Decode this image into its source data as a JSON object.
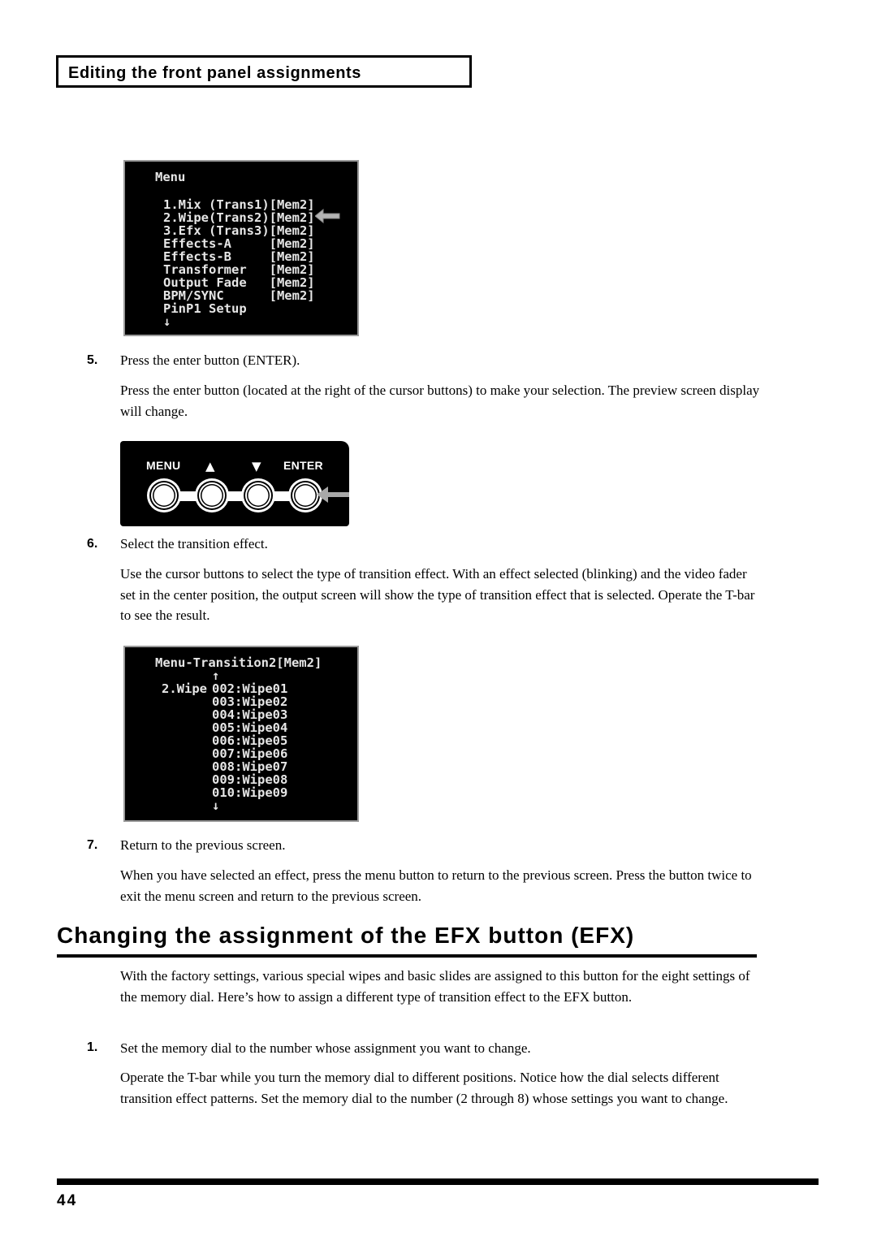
{
  "section_header": "Editing the front panel assignments",
  "screen1": {
    "title": "Menu",
    "items": [
      "1.Mix (Trans1)[Mem2]",
      "2.Wipe(Trans2)[Mem2]",
      "3.Efx (Trans3)[Mem2]",
      "Effects-A     [Mem2]",
      "Effects-B     [Mem2]",
      "Transformer   [Mem2]",
      "Output Fade   [Mem2]",
      "BPM/SYNC      [Mem2]",
      "PinP1 Setup"
    ],
    "scroll_down": "↓",
    "pointer_icon": "left-arrow-icon"
  },
  "steps": [
    {
      "number": "5.",
      "title": "Press the enter button (ENTER).",
      "body": "Press the enter button (located at the right of the cursor buttons) to make your selection. The preview screen display will change."
    },
    {
      "number": "6.",
      "title": "Select the transition effect.",
      "body": "Use the cursor buttons to select the type of transition effect. With an effect selected (blinking) and the video fader set in the center position, the output screen will show the type of transition effect that is selected. Operate the T-bar to see the result."
    },
    {
      "number": "7.",
      "title": "Return to the previous screen.",
      "body": "When you have selected an effect, press the menu button to return to the previous screen. Press the button twice to exit the menu screen and return to the previous screen."
    }
  ],
  "button_panel": {
    "menu_label": "MENU",
    "up_label": "▲",
    "down_label": "▼",
    "enter_label": "ENTER"
  },
  "screen2": {
    "title": "Menu-Transition2[Mem2]",
    "scroll_up": "↑",
    "category": "2.Wipe",
    "items": [
      "002:Wipe01",
      "003:Wipe02",
      "004:Wipe03",
      "005:Wipe04",
      "006:Wipe05",
      "007:Wipe06",
      "008:Wipe07",
      "009:Wipe08",
      "010:Wipe09"
    ],
    "scroll_down": "↓"
  },
  "efx_section": {
    "heading": "Changing the assignment of the EFX button (EFX)",
    "intro": "With the factory settings, various special wipes and basic slides are assigned to this button for the eight settings of the memory dial. Here’s how to assign a different type of transition effect to the EFX button.",
    "step1": {
      "number": "1.",
      "title": "Set the memory dial to the number whose assignment you want to change.",
      "body": "Operate the T-bar while you turn the memory dial to different positions. Notice how the dial selects different transition effect patterns. Set the memory dial to the number (2 through 8) whose settings you want to change."
    }
  },
  "page_number": "44"
}
